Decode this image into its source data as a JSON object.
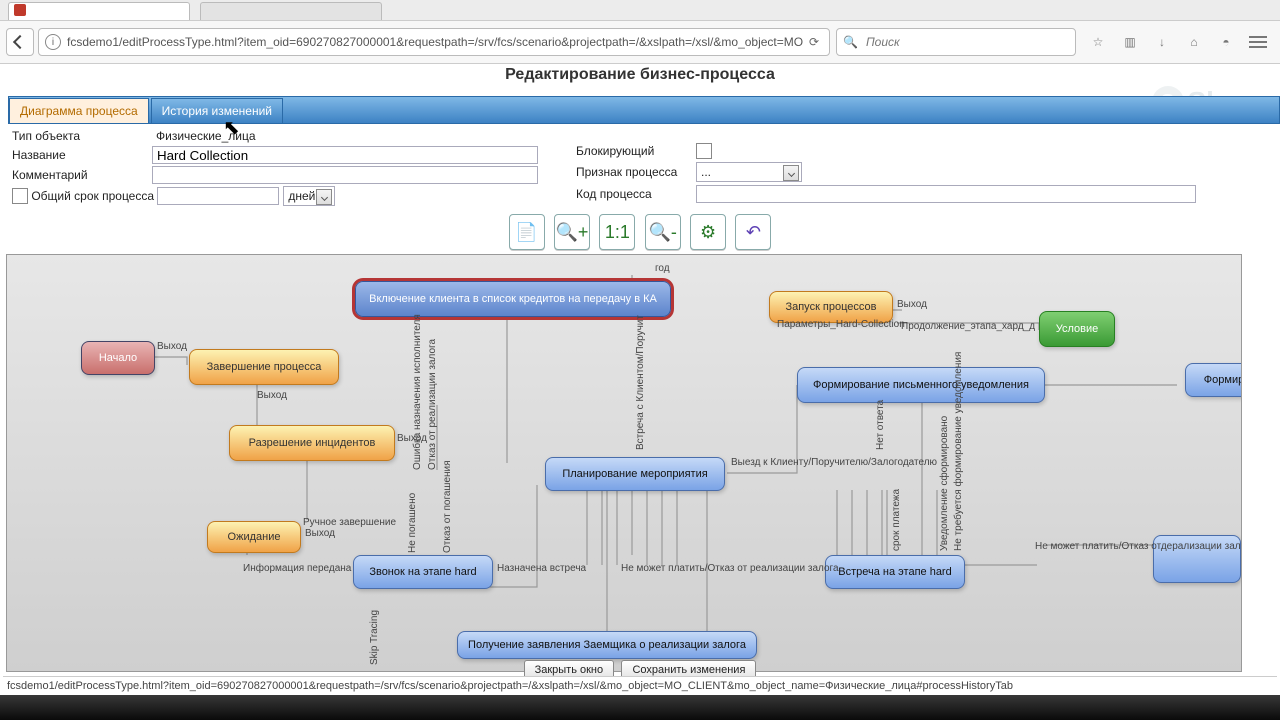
{
  "browser": {
    "url": "fcsdemo1/editProcessType.html?item_oid=690270827000001&requestpath=/srv/fcs/scenario&projectpath=/&xslpath=/xsl/&mo_object=MO",
    "search_placeholder": "Поиск"
  },
  "page": {
    "title": "Редактирование бизнес-процесса"
  },
  "tabs": {
    "active": "Диаграмма процесса",
    "inactive": "История изменений"
  },
  "watermark": "Skype",
  "form": {
    "type_label": "Тип объекта",
    "type_value": "Физические_лица",
    "name_label": "Название",
    "name_value": "Hard Collection",
    "comment_label": "Комментарий",
    "comment_value": "",
    "total_label": "Общий срок процесса",
    "total_value": "",
    "unit": "дней",
    "blocking_label": "Блокирующий",
    "flag_label": "Признак процесса",
    "flag_value": "...",
    "code_label": "Код процесса",
    "code_value": ""
  },
  "nodes": {
    "include": "Включение клиента в список кредитов на передачу в КА",
    "start_proc": "Запуск процессов",
    "start": "Начало",
    "complete": "Завершение процесса",
    "incidents": "Разрешение инцидентов",
    "wait": "Ожидание",
    "call": "Звонок на этапе hard",
    "plan": "Планирование мероприятия",
    "notify": "Формирование письменного уведомления",
    "cond": "Условие",
    "formir2": "Формир",
    "meeting": "Встреча на этапе hard",
    "recv": "Получение заявления Заемщика о реализации залога"
  },
  "labels": {
    "god": "год",
    "vyhod": "Выход",
    "params": "Параметры_Hard-Collection",
    "prodolz": "Продолжение_этапа_хард_д",
    "info": "Информация передана",
    "ruchnoe": "Ручное завершение",
    "naznach": "Назначена встреча",
    "otkaz_pog": "Отказ от погашения",
    "ne_pog": "Не погашено",
    "oshibka": "Ошибка назначения исполнителя",
    "otkaz_real": "Отказ от реализации залога",
    "vyezd": "Выезд к Клиенту/Поручителю/Залогодателю",
    "vstrecha": "Встреча с Клиентом/Поручит",
    "ne_mozhet": "Не может платить/Отказ от реализации залога",
    "ne_treb": "Не требуется формирование уведомления",
    "hardtop": "Не может платить/Отказ отдерализации залога",
    "skip": "Skip Tracing",
    "former": "Уведомление сформировано",
    "net_otv": "Нет ответа",
    "srok": "срок платежа"
  },
  "footer": {
    "close": "Закрыть окно",
    "save": "Сохранить изменения"
  },
  "status": "fcsdemo1/editProcessType.html?item_oid=690270827000001&requestpath=/srv/fcs/scenario&projectpath=/&xslpath=/xsl/&mo_object=MO_CLIENT&mo_object_name=Физические_лица#processHistoryTab"
}
